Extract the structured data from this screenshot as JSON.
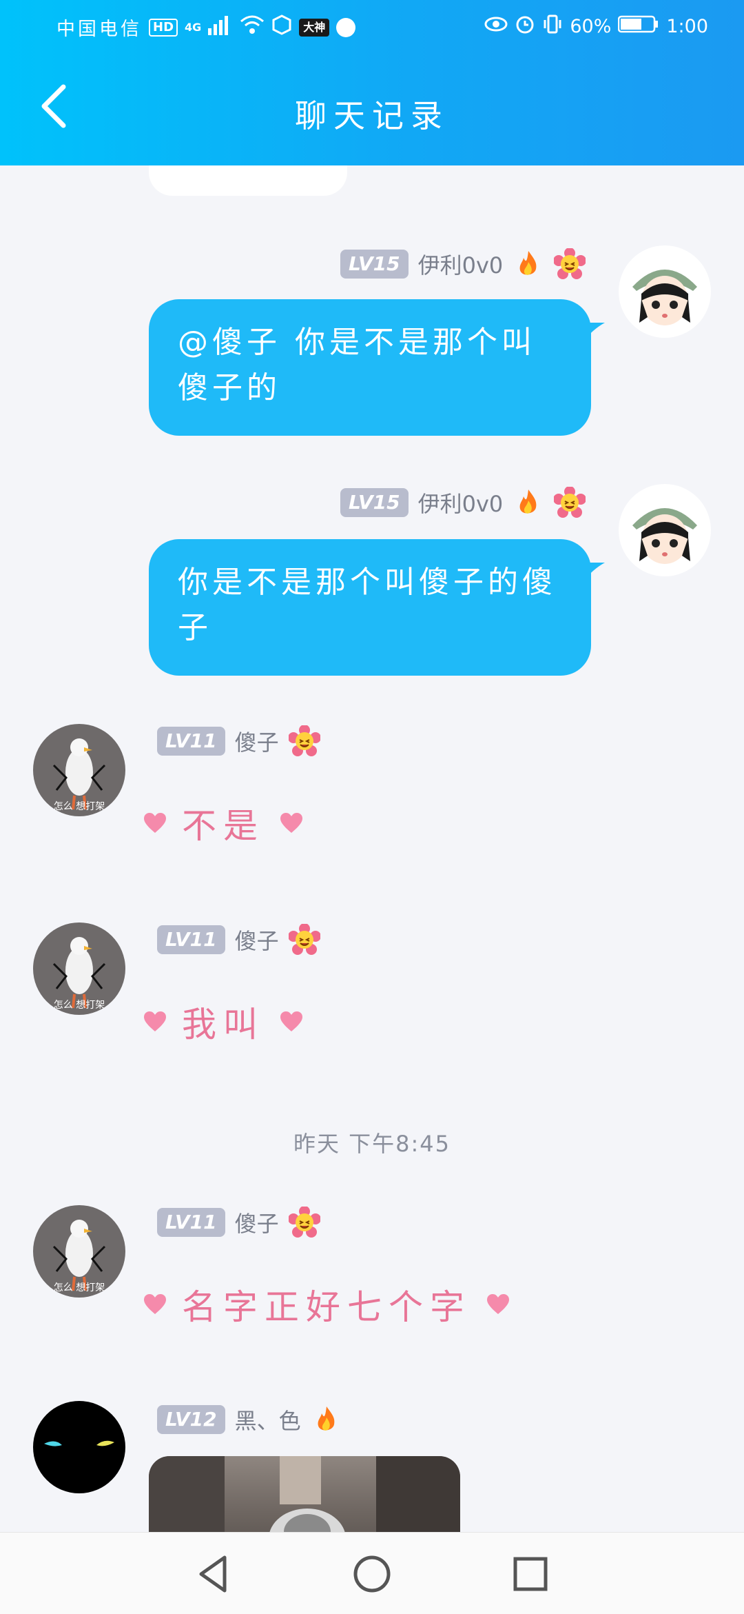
{
  "status_bar": {
    "carrier": "中国电信",
    "hd_badge": "HD",
    "network": "4G",
    "app_badge": "大神",
    "battery": "60%",
    "time": "1:00"
  },
  "header": {
    "title": "聊天记录",
    "back_icon": "chevron-left-icon"
  },
  "messages": [
    {
      "side": "right",
      "level": "LV15",
      "name": "伊利0v0",
      "text": "@傻子 你是不是那个叫傻子的",
      "badges": [
        "fire-icon",
        "flower-emoji-icon"
      ]
    },
    {
      "side": "right",
      "level": "LV15",
      "name": "伊利0v0",
      "text": "你是不是那个叫傻子的傻子",
      "badges": [
        "fire-icon",
        "flower-emoji-icon"
      ]
    },
    {
      "side": "left",
      "level": "LV11",
      "name": "傻子",
      "text": "不是",
      "avatar_caption": "怎么 想打架",
      "badges": [
        "flower-emoji-icon"
      ]
    },
    {
      "side": "left",
      "level": "LV11",
      "name": "傻子",
      "text": "我叫",
      "avatar_caption": "怎么 想打架",
      "badges": [
        "flower-emoji-icon"
      ]
    },
    {
      "side": "left",
      "level": "LV11",
      "name": "傻子",
      "text": "名字正好七个字",
      "avatar_caption": "怎么 想打架",
      "badges": [
        "flower-emoji-icon"
      ]
    },
    {
      "side": "left",
      "level": "LV12",
      "name": "黑、色",
      "badges": [
        "fire-icon"
      ],
      "content_type": "image"
    }
  ],
  "time_separator": "昨天 下午8:45",
  "colors": {
    "header_start": "#00c2fb",
    "header_end": "#1b9af2",
    "bubble": "#1fbaf8",
    "pink_text": "#e87597",
    "level_badge": "#b8bccd"
  },
  "nav": {
    "back": "back-triangle-icon",
    "home": "home-circle-icon",
    "recents": "recents-square-icon"
  }
}
